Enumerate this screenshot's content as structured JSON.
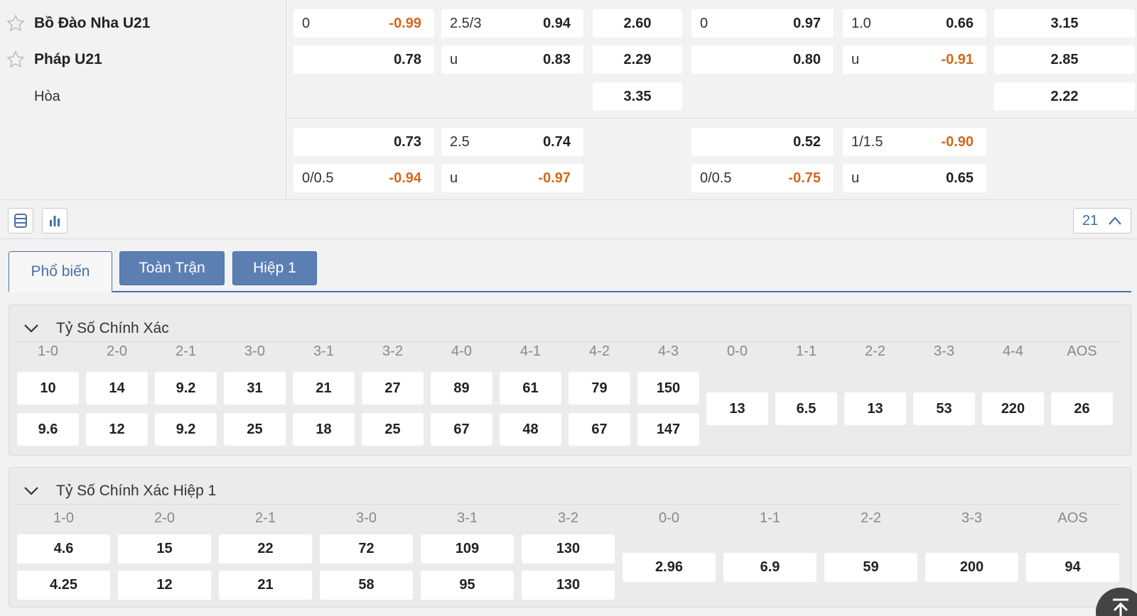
{
  "teams": {
    "home": "Bồ Đào Nha U21",
    "away": "Pháp U21",
    "draw": "Hòa"
  },
  "odds_row1": {
    "hdp_full": {
      "line": "0",
      "home": "-0.99",
      "away": "0.78"
    },
    "ou_full": {
      "line": "2.5/3",
      "over": "0.94",
      "under_label": "u",
      "under": "0.83"
    },
    "x12_full": {
      "home": "2.60",
      "away": "2.29",
      "draw": "3.35"
    },
    "hdp_h1": {
      "line": "0",
      "home": "0.97",
      "away": "0.80"
    },
    "ou_h1": {
      "line": "1.0",
      "over": "0.66",
      "under_label": "u",
      "under": "-0.91"
    },
    "x12_h1": {
      "home": "3.15",
      "away": "2.85",
      "draw": "2.22"
    }
  },
  "odds_row2": {
    "hdp_full": {
      "home": "0.73",
      "line": "0/0.5",
      "away": "-0.94"
    },
    "ou_full": {
      "line": "2.5",
      "over": "0.74",
      "under_label": "u",
      "under": "-0.97"
    },
    "hdp_h1": {
      "home": "0.52",
      "line": "0/0.5",
      "away": "-0.75"
    },
    "ou_h1": {
      "line": "1/1.5",
      "over": "-0.90",
      "under_label": "u",
      "under": "0.65"
    }
  },
  "toolbar": {
    "count": "21",
    "list_icon": "list-view-icon",
    "chart_icon": "bar-chart-icon"
  },
  "tabs": [
    {
      "label": "Phổ biến",
      "active": true
    },
    {
      "label": "Toàn Trận",
      "active": false
    },
    {
      "label": "Hiệp 1",
      "active": false
    }
  ],
  "market_full": {
    "title": "Tỷ Số Chính Xác",
    "home_scores": [
      "1-0",
      "2-0",
      "2-1",
      "3-0",
      "3-1",
      "3-2",
      "4-0",
      "4-1",
      "4-2",
      "4-3"
    ],
    "home_row1": [
      "10",
      "14",
      "9.2",
      "31",
      "21",
      "27",
      "89",
      "61",
      "79",
      "150"
    ],
    "home_row2": [
      "9.6",
      "12",
      "9.2",
      "25",
      "18",
      "25",
      "67",
      "48",
      "67",
      "147"
    ],
    "draw_scores": [
      "0-0",
      "1-1",
      "2-2",
      "3-3",
      "4-4",
      "AOS"
    ],
    "draw_odds": [
      "13",
      "6.5",
      "13",
      "53",
      "220",
      "26"
    ]
  },
  "market_h1": {
    "title": "Tỷ Số Chính Xác Hiệp 1",
    "home_scores": [
      "1-0",
      "2-0",
      "2-1",
      "3-0",
      "3-1",
      "3-2"
    ],
    "home_row1": [
      "4.6",
      "15",
      "22",
      "72",
      "109",
      "130"
    ],
    "home_row2": [
      "4.25",
      "12",
      "21",
      "58",
      "95",
      "130"
    ],
    "draw_scores": [
      "0-0",
      "1-1",
      "2-2",
      "3-3",
      "AOS"
    ],
    "draw_odds": [
      "2.96",
      "6.9",
      "59",
      "200",
      "94"
    ]
  },
  "colors": {
    "negative": "#d2691e",
    "accent": "#4a6fa5",
    "tab_button": "#5b7fb3"
  }
}
